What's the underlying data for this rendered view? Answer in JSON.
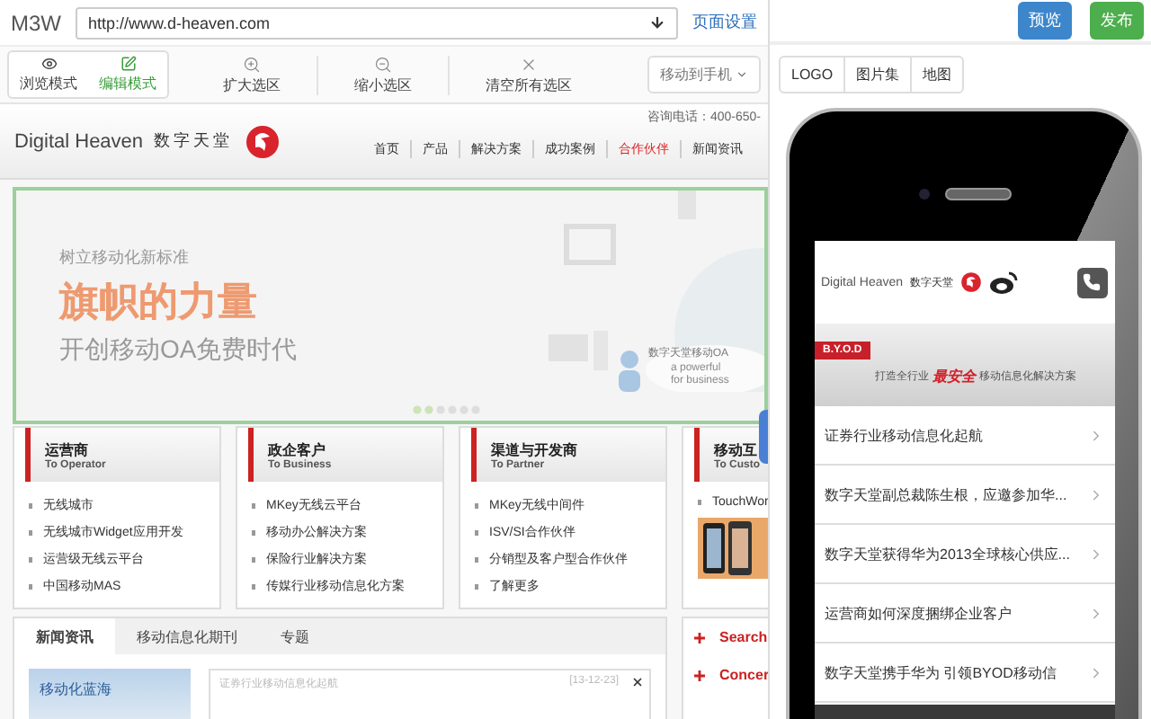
{
  "app": {
    "name": "M3W",
    "url": "http://www.d-heaven.com",
    "settings_link": "页面设置"
  },
  "modes": [
    {
      "label": "浏览模式",
      "kind": "view",
      "selected": false
    },
    {
      "label": "编辑模式",
      "kind": "edit",
      "selected": true
    }
  ],
  "tools": [
    {
      "label": "扩大选区",
      "kind": "zoom-in"
    },
    {
      "label": "缩小选区",
      "kind": "zoom-out"
    },
    {
      "label": "清空所有选区",
      "kind": "clear"
    }
  ],
  "move_menu": "移动到手机",
  "site": {
    "logo_en": "Digital Heaven",
    "logo_cn": "数字天堂",
    "hotline": "咨询电话：400-650-",
    "nav": [
      {
        "label": "首页",
        "selected": false
      },
      {
        "label": "产品",
        "selected": false
      },
      {
        "label": "解决方案",
        "selected": false
      },
      {
        "label": "成功案例",
        "selected": false
      },
      {
        "label": "合作伙伴",
        "selected": true
      },
      {
        "label": "新闻资讯",
        "selected": false
      }
    ],
    "banner": {
      "kicker": "树立移动化新标准",
      "headline": "旗帜的力量",
      "subline": "开创移动OA免费时代",
      "cloud_title": "数字天堂移动OA",
      "cloud_text": "a powerful for business"
    },
    "categories": [
      {
        "title": "运营商",
        "subtitle": "To Operator",
        "kind": "links",
        "links": [
          "无线城市",
          "无线城市Widget应用开发",
          "运营级无线云平台",
          "中国移动MAS"
        ]
      },
      {
        "title": "政企客户",
        "subtitle": "To Business",
        "kind": "links",
        "links": [
          "MKey无线云平台",
          "移动办公解决方案",
          "保险行业解决方案",
          "传媒行业移动信息化方案"
        ]
      },
      {
        "title": "渠道与开发商",
        "subtitle": "To Partner",
        "kind": "links",
        "links": [
          "MKey无线中间件",
          "ISV/SI合作伙伴",
          "分销型及客户型合作伙伴",
          "了解更多"
        ]
      },
      {
        "title": "移动互",
        "subtitle": "To Custo",
        "kind": "picture",
        "links": [
          "TouchWor"
        ]
      }
    ],
    "news_tabs": [
      {
        "label": "新闻资讯",
        "selected": true
      },
      {
        "label": "移动信息化期刊",
        "selected": false
      },
      {
        "label": "专题",
        "selected": false
      }
    ],
    "news_feature": "移动化蓝海",
    "news": [
      {
        "title": "证券行业移动信息化起航",
        "date": "[13-12-23]"
      }
    ],
    "side_boxes": [
      "Search",
      "Concer"
    ]
  },
  "actions": [
    {
      "label": "预览",
      "kind": "primary"
    },
    {
      "label": "发布",
      "kind": "success"
    }
  ],
  "widget_tabs": [
    "LOGO",
    "图片集",
    "地图"
  ],
  "phone": {
    "logo_en": "Digital Heaven",
    "logo_cn": "数字天堂",
    "banner": {
      "badge": "B.Y.O.D",
      "lead": "打造全行业",
      "highlight": "最安全",
      "tail": "移动信息化解决方案"
    },
    "items": [
      "证券行业移动信息化起航",
      "数字天堂副总裁陈生根，应邀参加华...",
      "数字天堂获得华为2013全球核心供应...",
      "运营商如何深度捆绑企业客户",
      "数字天堂携手华为 引领BYOD移动信"
    ]
  }
}
